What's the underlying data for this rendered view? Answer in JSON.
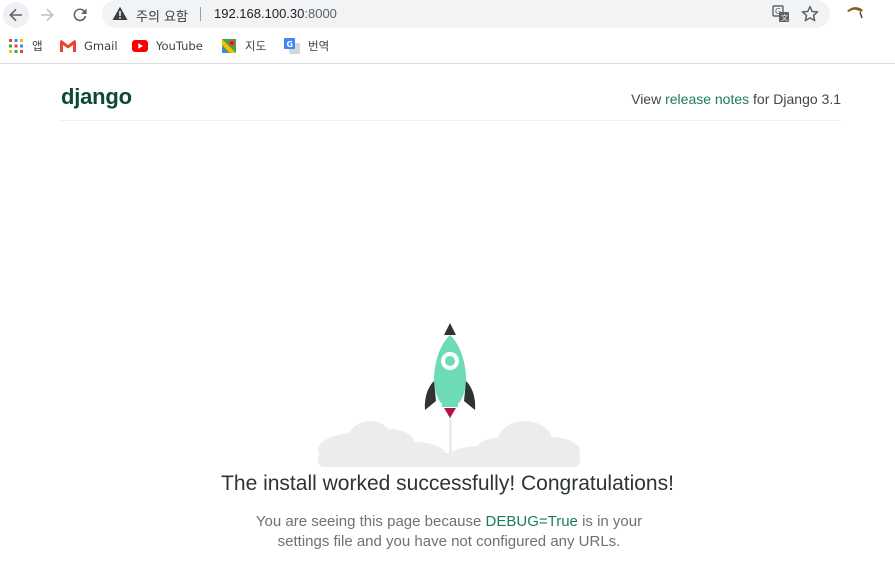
{
  "browser": {
    "security_warning": "주의 요함",
    "url_host": "192.168.100.30",
    "url_port": ":8000",
    "bookmarks": [
      {
        "label": "앱",
        "icon": "apps-grid-icon"
      },
      {
        "label": "Gmail",
        "icon": "gmail-icon"
      },
      {
        "label": "YouTube",
        "icon": "youtube-icon"
      },
      {
        "label": "지도",
        "icon": "maps-icon"
      },
      {
        "label": "번역",
        "icon": "translate-icon"
      }
    ]
  },
  "header": {
    "logo": "django",
    "release_prefix": "View ",
    "release_link": "release notes",
    "release_suffix": " for Django 3.1"
  },
  "main": {
    "headline": "The install worked successfully! Congratulations!",
    "sub_before": "You are seeing this page because ",
    "sub_debug": "DEBUG=True",
    "sub_after": " is in your settings file and you have not configured any URLs."
  },
  "colors": {
    "django_green": "#0c4b33",
    "link_green": "#1d7c58",
    "rocket_body": "#6ddbb5",
    "rocket_dark": "#2e3436",
    "rocket_flame": "#b11643",
    "cloud": "#ebeced"
  }
}
